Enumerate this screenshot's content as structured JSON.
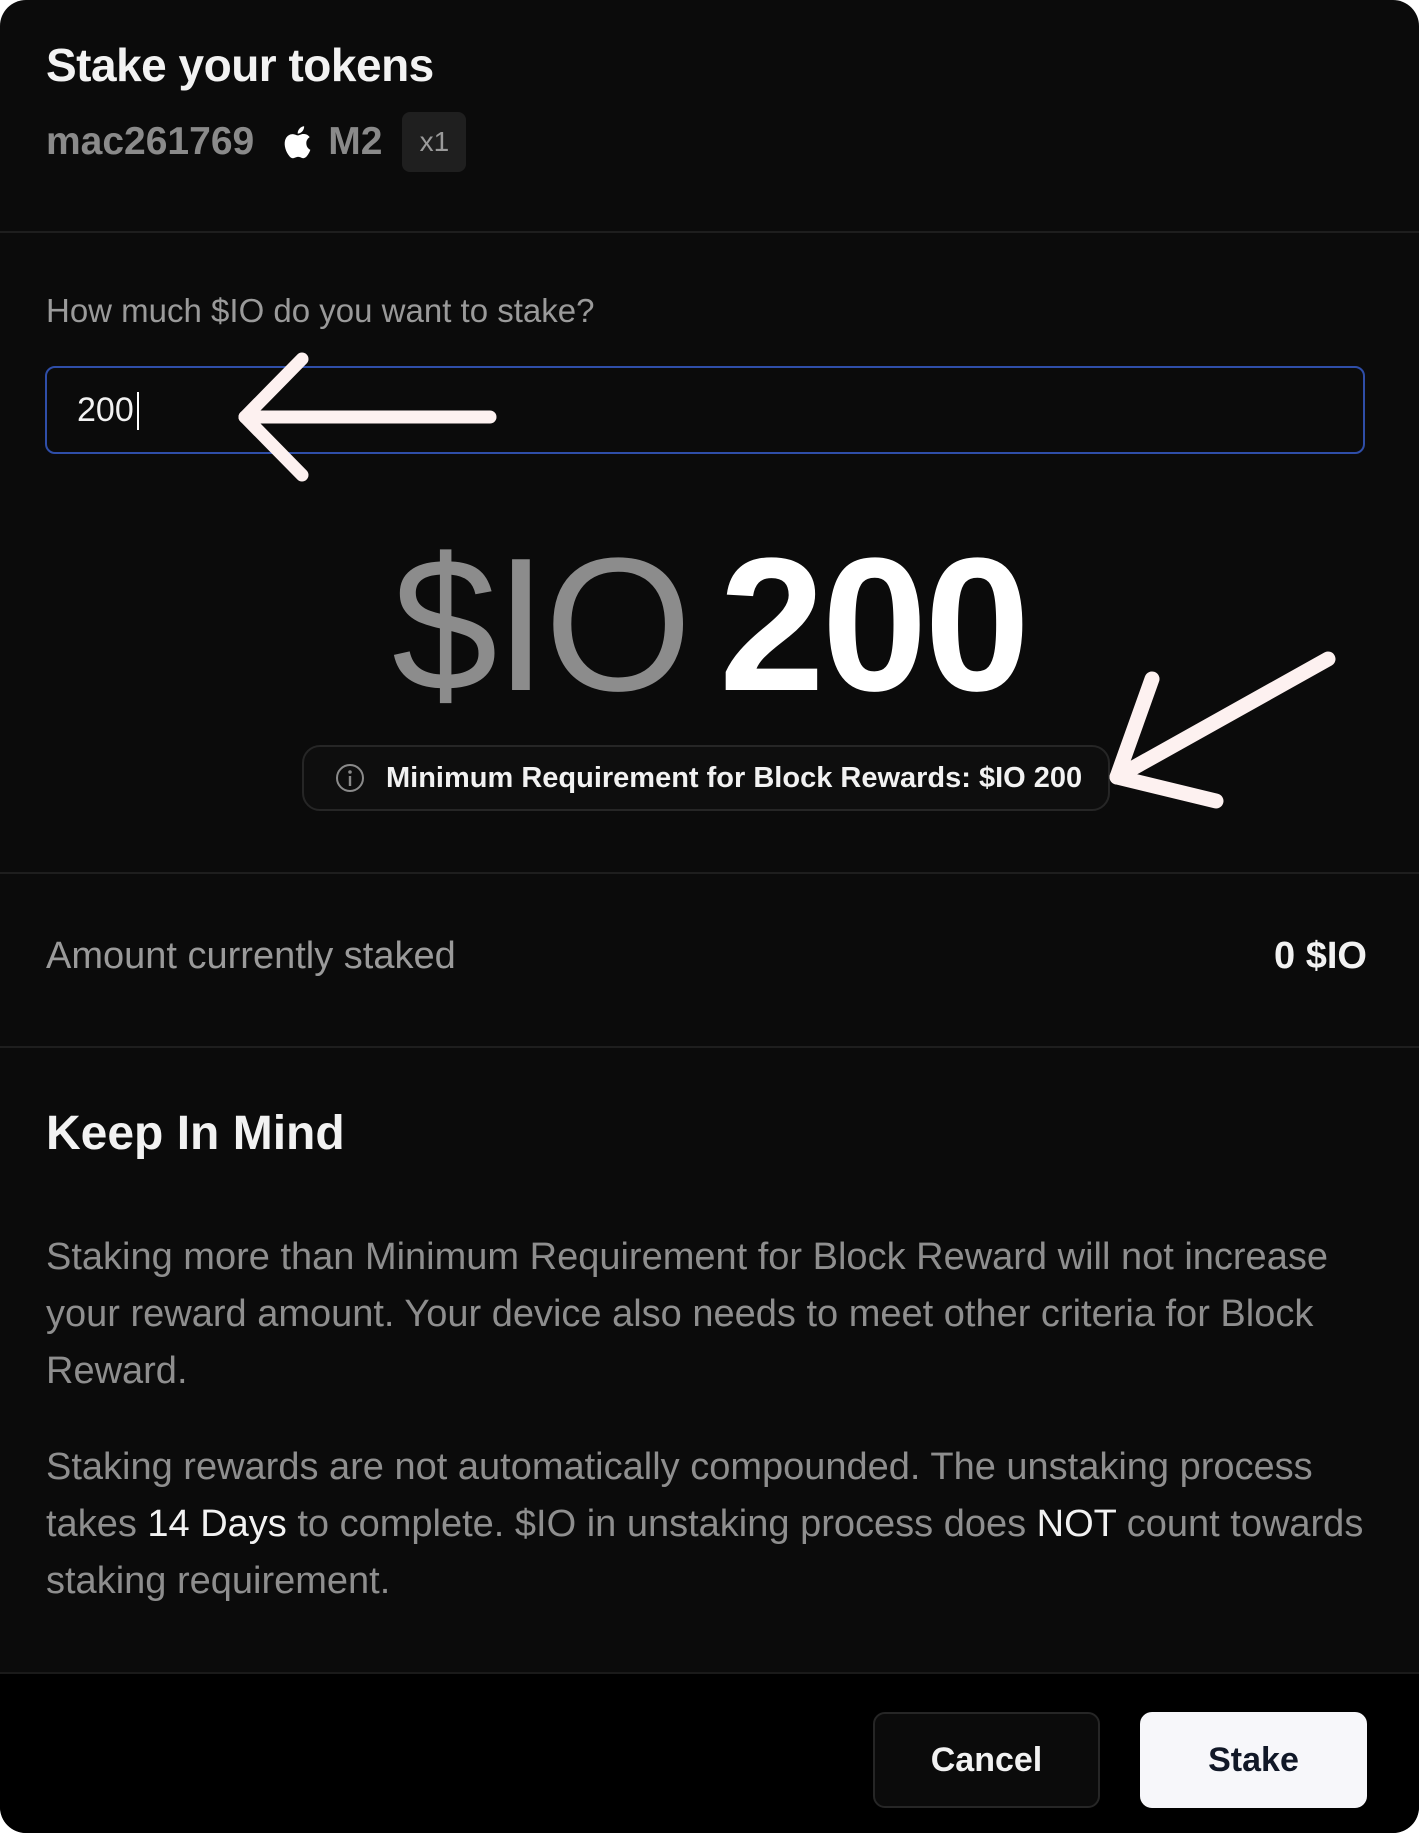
{
  "modal": {
    "title": "Stake your tokens",
    "device": {
      "name": "mac261769",
      "icon": "apple-icon",
      "chip": "M2",
      "count": "x1"
    }
  },
  "stake_form": {
    "question": "How much $IO do you want to stake?",
    "input_value": "200"
  },
  "preview": {
    "currency": "$IO",
    "amount": "200",
    "requirement_icon": "info-icon",
    "requirement_text": "Minimum Requirement for Block Rewards: $IO 200"
  },
  "staked": {
    "label": "Amount currently staked",
    "value": "0 $IO"
  },
  "keep_in_mind": {
    "title": "Keep In Mind",
    "para1": "Staking more than Minimum Requirement for Block Reward will not increase your reward amount. Your device also needs to meet other criteria for Block Reward.",
    "para2_a": "Staking rewards are not automatically compounded. The unstaking process takes ",
    "para2_days": "14 Days",
    "para2_b": " to complete. $IO in unstaking process does ",
    "para2_not": "NOT",
    "para2_c": " count towards staking requirement."
  },
  "footer": {
    "cancel_label": "Cancel",
    "stake_label": "Stake"
  },
  "colors": {
    "background": "#0b0b0b",
    "input_border": "#2f4ea8",
    "annotation_arrow": "#fdf1f0",
    "muted_text": "#8e8e8e"
  }
}
